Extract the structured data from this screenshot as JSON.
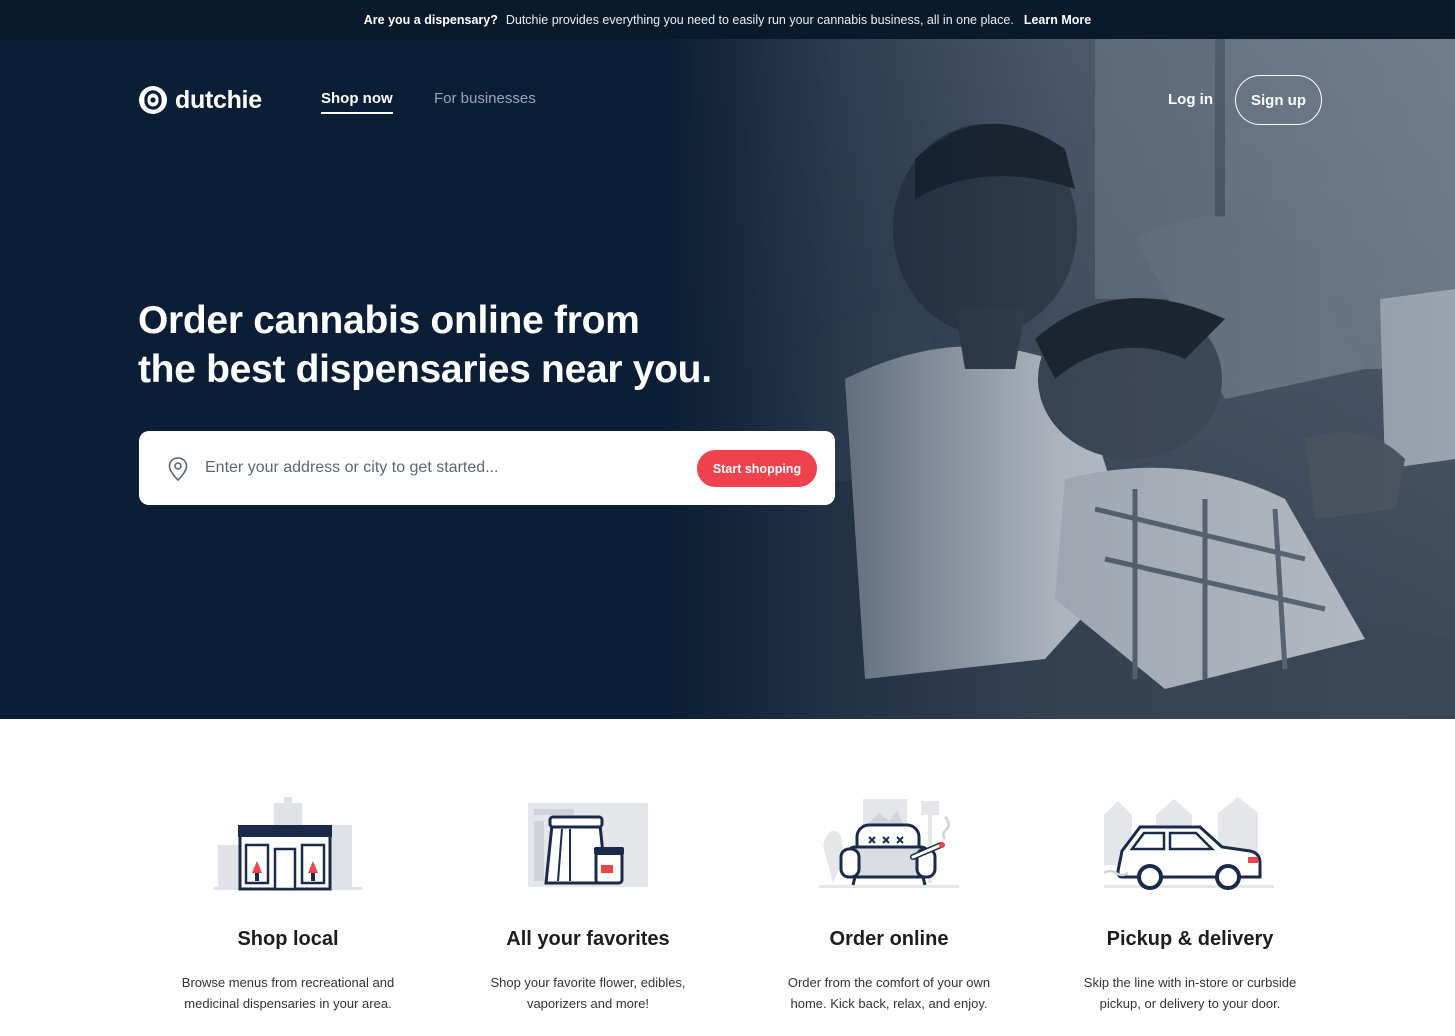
{
  "banner": {
    "question": "Are you a dispensary?",
    "message": "Dutchie provides everything you need to easily run your cannabis business, all in one place.",
    "link": "Learn More"
  },
  "header": {
    "logo_text": "dutchie",
    "nav": {
      "shop_now": "Shop now",
      "for_businesses": "For businesses"
    },
    "login": "Log in",
    "signup": "Sign up"
  },
  "hero": {
    "headline_line1": "Order cannabis online from",
    "headline_line2": "the best dispensaries near you.",
    "search_placeholder": "Enter your address or city to get started...",
    "cta": "Start shopping"
  },
  "features": [
    {
      "icon": "storefront-icon",
      "title": "Shop local",
      "line1": "Browse menus from recreational and",
      "line2": "medicinal dispensaries in your area."
    },
    {
      "icon": "shopping-bag-icon",
      "title": "All your favorites",
      "line1": "Shop your favorite flower, edibles,",
      "line2": "vaporizers and more!"
    },
    {
      "icon": "couch-icon",
      "title": "Order online",
      "line1": "Order from the comfort of your own",
      "line2": "home. Kick back, relax, and enjoy."
    },
    {
      "icon": "car-icon",
      "title": "Pickup & delivery",
      "line1": "Skip the line with in-store or curbside",
      "line2": "pickup, or delivery to your door."
    }
  ],
  "colors": {
    "navy": "#0c1e35",
    "accent": "#f0414f",
    "banner": "#0b1a2b"
  }
}
